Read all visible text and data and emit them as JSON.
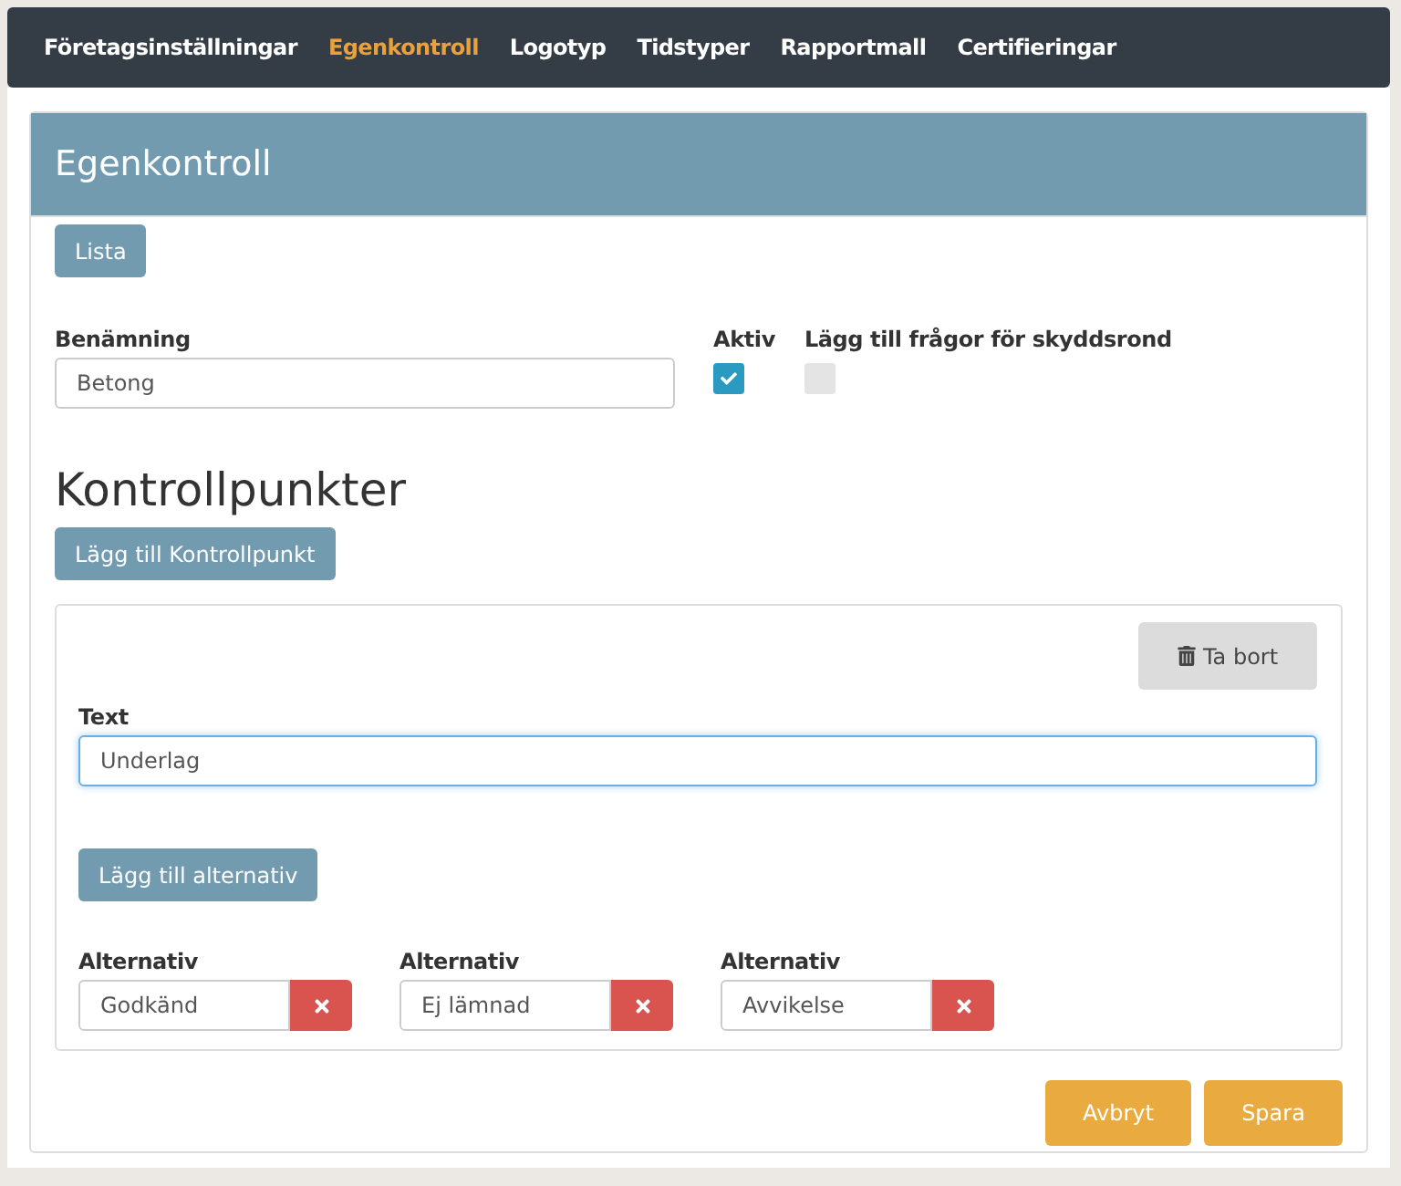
{
  "nav": [
    {
      "label": "Företagsinställningar",
      "selected": false
    },
    {
      "label": "Egenkontroll",
      "selected": true
    },
    {
      "label": "Logotyp",
      "selected": false
    },
    {
      "label": "Tidstyper",
      "selected": false
    },
    {
      "label": "Rapportmall",
      "selected": false
    },
    {
      "label": "Certifieringar",
      "selected": false
    }
  ],
  "panel": {
    "title": "Egenkontroll",
    "list_button": "Lista",
    "name_field": {
      "label": "Benämning",
      "value": "Betong"
    },
    "checkboxes": [
      {
        "label": "Aktiv",
        "checked": true
      },
      {
        "label": "Lägg till frågor för skyddsrond",
        "checked": false
      }
    ],
    "section_title": "Kontrollpunkter",
    "add_button": "Lägg till Kontrollpunkt",
    "checkpoints": [
      {
        "delete_button": "Ta bort",
        "text_field": {
          "label": "Text",
          "value": "Underlag",
          "focused": true
        },
        "add_option_button": "Lägg till alternativ",
        "options": [
          {
            "label": "Alternativ",
            "value": "Godkänd"
          },
          {
            "label": "Alternativ",
            "value": "Ej lämnad"
          },
          {
            "label": "Alternativ",
            "value": "Avvikelse"
          }
        ]
      }
    ],
    "footer_buttons": [
      "Avbryt",
      "Spara"
    ]
  }
}
